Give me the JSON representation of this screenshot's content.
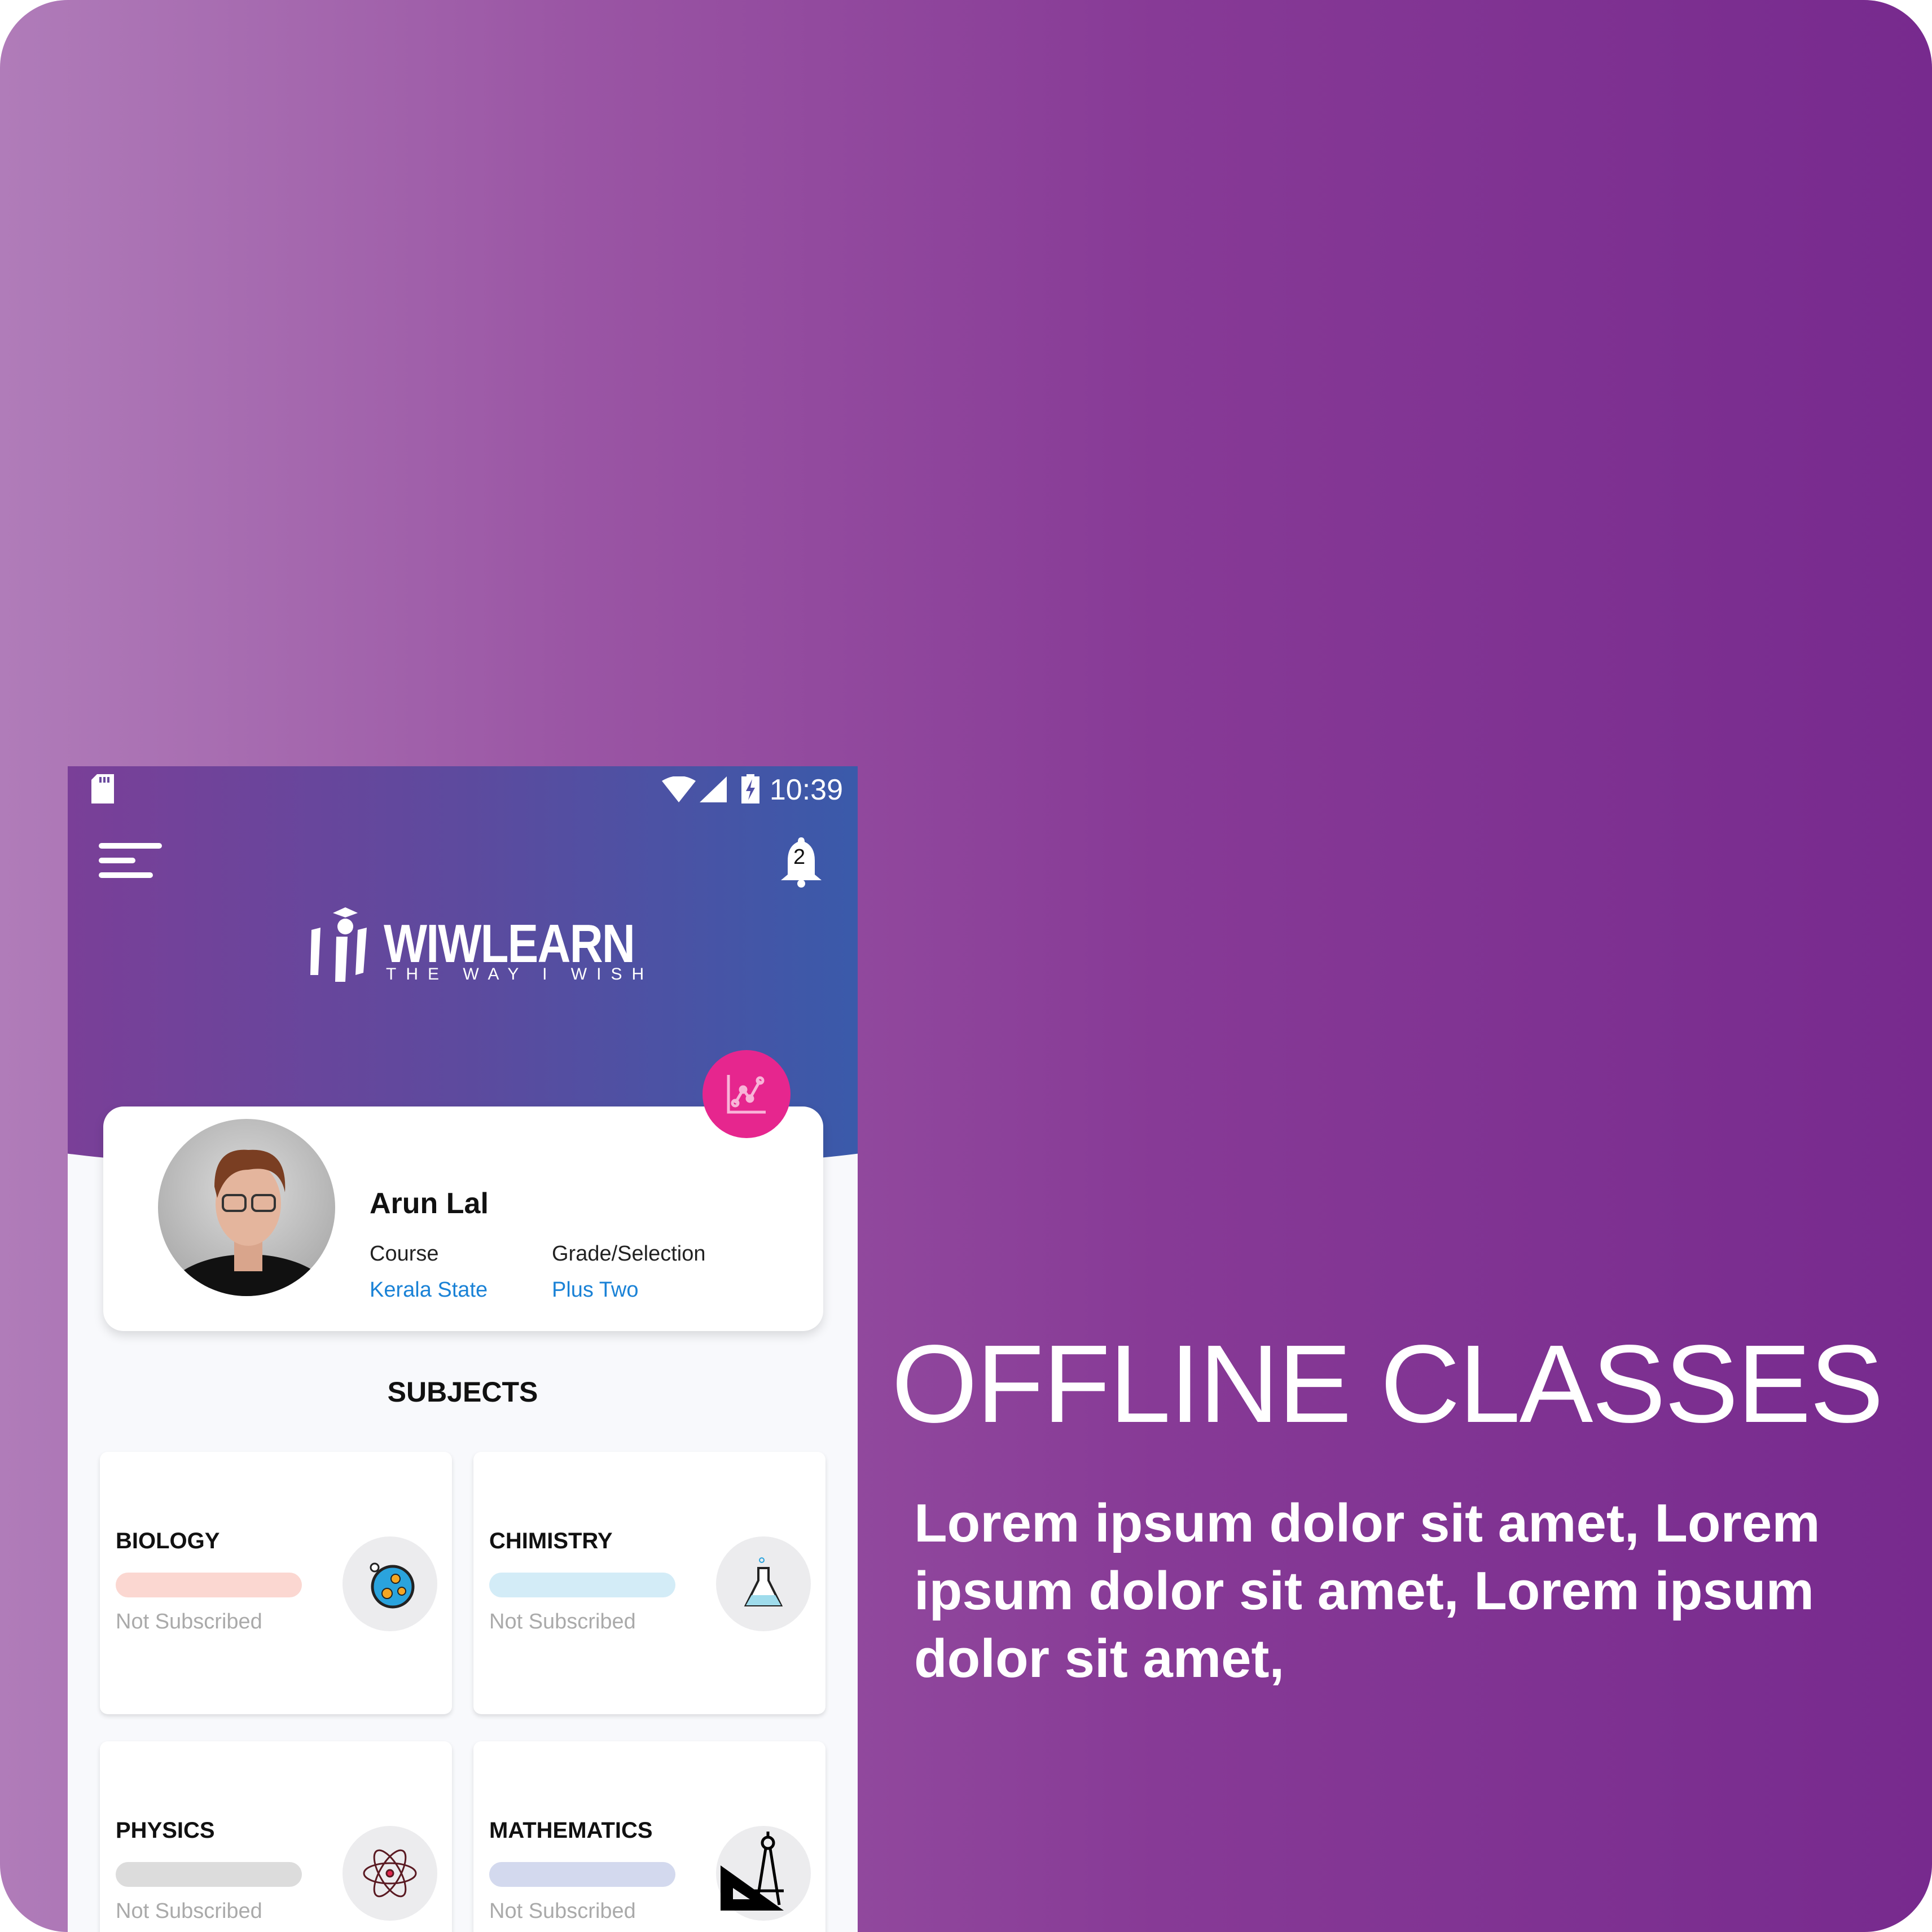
{
  "status_bar": {
    "time": "10:39"
  },
  "header": {
    "notification_count": "2",
    "logo": {
      "name": "WIWLEARN",
      "tagline": "THE WAY I WISH"
    }
  },
  "profile": {
    "name": "Arun Lal",
    "course_label": "Course",
    "course_value": "Kerala State",
    "grade_label": "Grade/Selection",
    "grade_value": "Plus Two"
  },
  "subjects": {
    "title": "SUBJECTS",
    "items": [
      {
        "name": "BIOLOGY",
        "status": "Not Subscribed",
        "color": "#fbd7d1",
        "icon": "petri-dish-icon"
      },
      {
        "name": "CHIMISTRY",
        "status": "Not Subscribed",
        "color": "#d3ecf7",
        "icon": "flask-icon"
      },
      {
        "name": "PHYSICS",
        "status": "Not Subscribed",
        "color": "#dcdcdc",
        "icon": "atom-icon"
      },
      {
        "name": "MATHEMATICS",
        "status": "Not Subscribed",
        "color": "#d3d9ee",
        "icon": "compass-ruler-icon"
      }
    ]
  },
  "promo": {
    "headline": "OFFLINE CLASSES",
    "body": "Lorem ipsum dolor sit amet,  Lorem ipsum dolor sit amet, Lorem ipsum dolor sit amet,"
  },
  "colors": {
    "accent": "#e6268e",
    "link": "#1a82d6"
  }
}
